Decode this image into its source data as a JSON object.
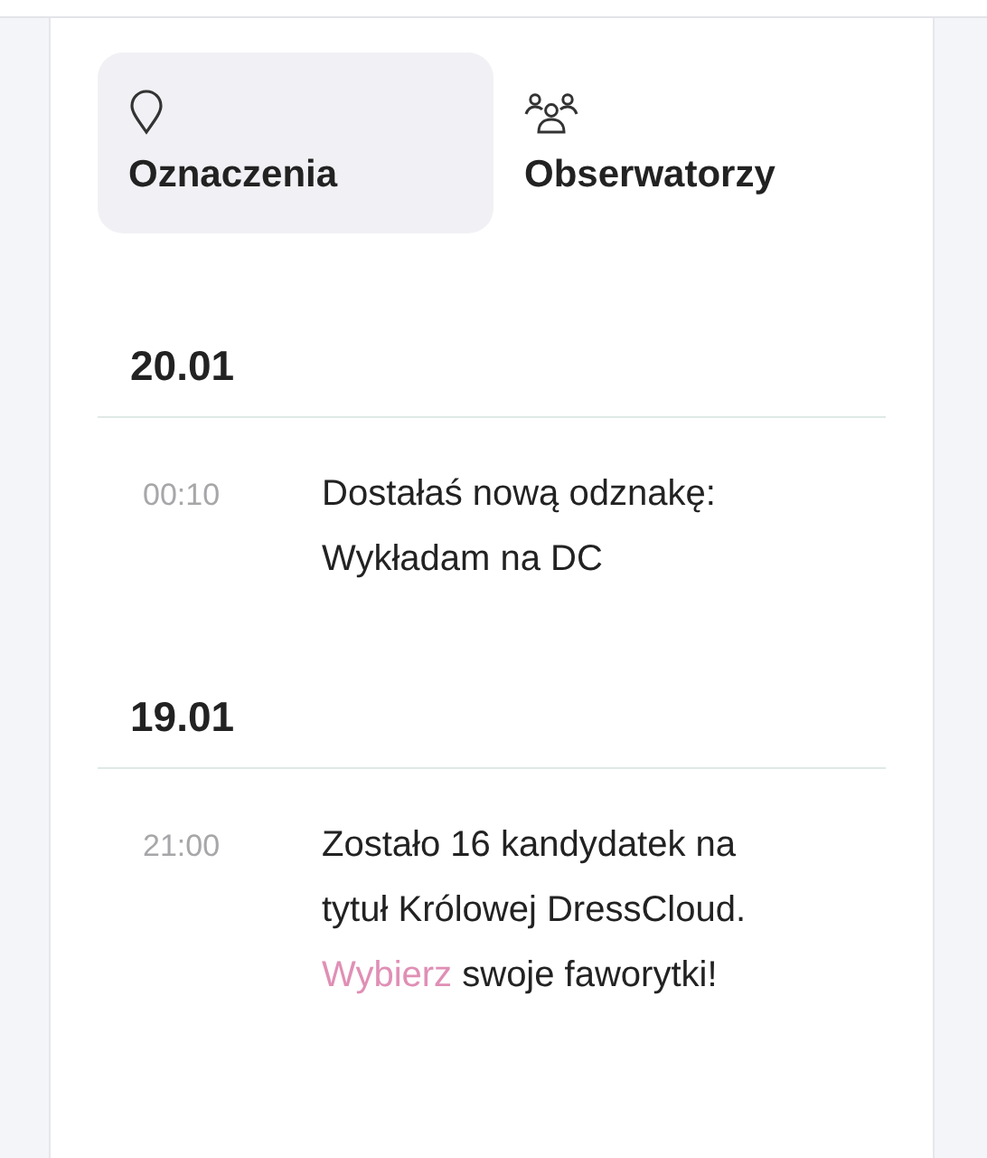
{
  "tabs": [
    {
      "label": "Oznaczenia",
      "selected": true
    },
    {
      "label": "Obserwatorzy",
      "selected": false
    }
  ],
  "groups": [
    {
      "date": "20.01",
      "entries": [
        {
          "time": "00:10",
          "lines": [
            [
              {
                "kind": "text",
                "text": "Dostałaś nową odznakę:"
              }
            ],
            [
              {
                "kind": "text",
                "text": "Wykładam na DC"
              }
            ]
          ]
        }
      ]
    },
    {
      "date": "19.01",
      "entries": [
        {
          "time": "21:00",
          "lines": [
            [
              {
                "kind": "text",
                "text": "Zostało 16 kandydatek na"
              }
            ],
            [
              {
                "kind": "text",
                "text": "tytuł Królowej DressCloud."
              }
            ],
            [
              {
                "kind": "link",
                "text": "Wybierz"
              },
              {
                "kind": "text",
                "text": " swoje faworytki!"
              }
            ]
          ]
        }
      ]
    }
  ]
}
